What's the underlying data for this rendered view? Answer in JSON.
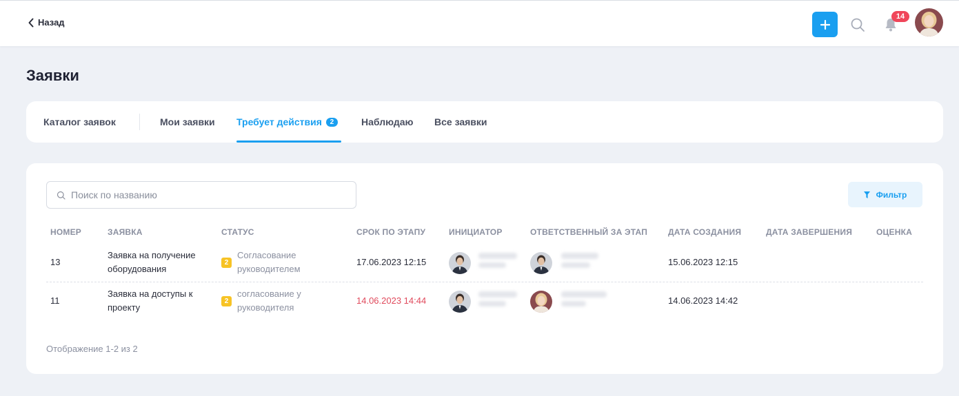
{
  "header": {
    "back_label": "Назад",
    "notifications_count": "14"
  },
  "page": {
    "title": "Заявки"
  },
  "tabs": [
    {
      "label": "Каталог заявок",
      "active": false
    },
    {
      "label": "Мои заявки",
      "active": false
    },
    {
      "label": "Требует действия",
      "active": true,
      "count": "2"
    },
    {
      "label": "Наблюдаю",
      "active": false
    },
    {
      "label": "Все заявки",
      "active": false
    }
  ],
  "search": {
    "placeholder": "Поиск по названию",
    "value": ""
  },
  "filter": {
    "label": "Фильтр"
  },
  "table": {
    "columns": [
      "НОМЕР",
      "ЗАЯВКА",
      "СТАТУС",
      "СРОК ПО ЭТАПУ",
      "ИНИЦИАТОР",
      "ОТВЕТСТВЕННЫЙ ЗА ЭТАП",
      "ДАТА СОЗДАНИЯ",
      "ДАТА ЗАВЕРШЕНИЯ",
      "ОЦЕНКА"
    ],
    "rows": [
      {
        "number": "13",
        "title_line1": "Заявка на получение",
        "title_line2": "оборудования",
        "status_count": "2",
        "status_line1": "Согласование",
        "status_line2": "руководителем",
        "deadline": "17.06.2023 12:15",
        "deadline_overdue": false,
        "created": "15.06.2023 12:15",
        "completed": "",
        "rating": ""
      },
      {
        "number": "11",
        "title_line1": "Заявка на доступы к",
        "title_line2": "проекту",
        "status_count": "2",
        "status_line1": "согласование у",
        "status_line2": "руководителя",
        "deadline": "14.06.2023 14:44",
        "deadline_overdue": true,
        "created": "14.06.2023 14:42",
        "completed": "",
        "rating": ""
      }
    ]
  },
  "pagination": {
    "summary": "Отображение 1-2 из 2"
  },
  "colors": {
    "accent": "#1a9ff0",
    "badge_red": "#f0465a",
    "status_yellow": "#f7c325",
    "overdue_red": "#e04a5c",
    "background": "#eef1f6"
  }
}
